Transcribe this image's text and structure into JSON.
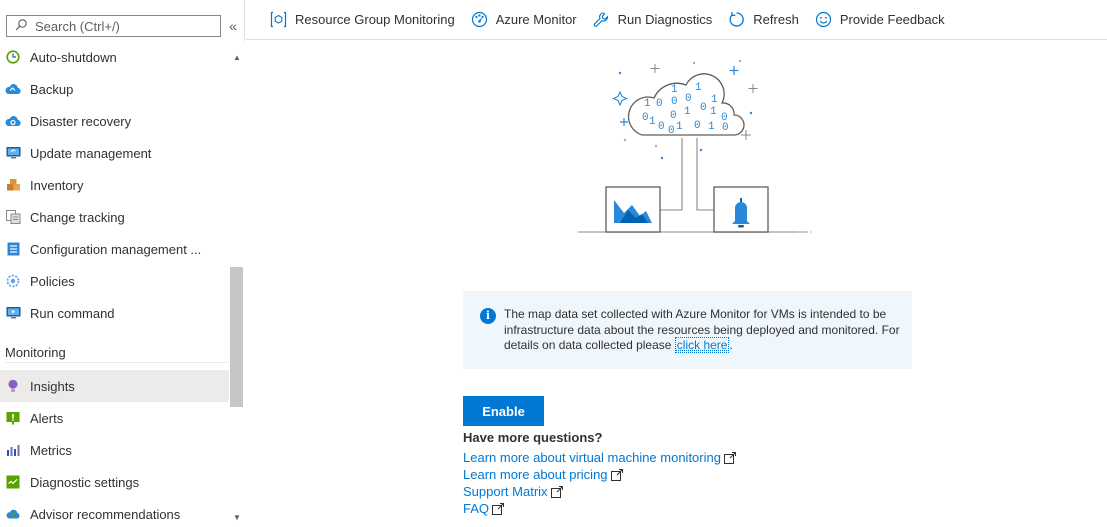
{
  "search": {
    "placeholder": "Search (Ctrl+/)",
    "collapse_glyph": "«"
  },
  "menu": {
    "items": [
      {
        "label": "Auto-shutdown",
        "icon": "clock-icon"
      },
      {
        "label": "Backup",
        "icon": "cloud-backup-icon"
      },
      {
        "label": "Disaster recovery",
        "icon": "cloud-recovery-icon"
      },
      {
        "label": "Update management",
        "icon": "monitor-update-icon"
      },
      {
        "label": "Inventory",
        "icon": "inventory-boxes-icon"
      },
      {
        "label": "Change tracking",
        "icon": "change-tracking-icon"
      },
      {
        "label": "Configuration management ...",
        "icon": "configuration-list-icon"
      },
      {
        "label": "Policies",
        "icon": "policies-gear-icon"
      },
      {
        "label": "Run command",
        "icon": "run-command-icon"
      }
    ],
    "monitoring_section": "Monitoring",
    "monitoring_items": [
      {
        "label": "Insights",
        "icon": "insights-bulb-icon",
        "selected": true
      },
      {
        "label": "Alerts",
        "icon": "alerts-icon"
      },
      {
        "label": "Metrics",
        "icon": "metrics-bar-icon"
      },
      {
        "label": "Diagnostic settings",
        "icon": "diagnostic-settings-icon"
      },
      {
        "label": "Advisor recommendations",
        "icon": "advisor-icon"
      }
    ]
  },
  "toolbar": {
    "items": [
      {
        "label": "Resource Group Monitoring",
        "icon": "resource-group-icon"
      },
      {
        "label": "Azure Monitor",
        "icon": "azure-monitor-icon"
      },
      {
        "label": "Run Diagnostics",
        "icon": "wrench-icon"
      },
      {
        "label": "Refresh",
        "icon": "refresh-icon"
      },
      {
        "label": "Provide Feedback",
        "icon": "smiley-icon"
      }
    ]
  },
  "illustration": {
    "binary_digits": [
      "1",
      "1",
      "0",
      "0",
      "1",
      "1",
      "0",
      "1",
      "0",
      "1",
      "0",
      "1",
      "0",
      "0",
      "1",
      "0",
      "1",
      "0",
      "0",
      "0"
    ]
  },
  "info": {
    "icon_glyph": "i",
    "text_before": "The map data set collected with Azure Monitor for VMs is intended to be infrastructure data about the resources being deployed and monitored. For details on data collected please ",
    "link_text": "click here",
    "text_after": "."
  },
  "enable_button": "Enable",
  "questions": {
    "heading": "Have more questions?",
    "links": [
      "Learn more about virtual machine monitoring",
      "Learn more about pricing",
      "Support Matrix",
      "FAQ"
    ]
  },
  "colors": {
    "accent": "#0078d4",
    "selected_bg": "#edebe9",
    "info_bg": "#eff6fc"
  }
}
